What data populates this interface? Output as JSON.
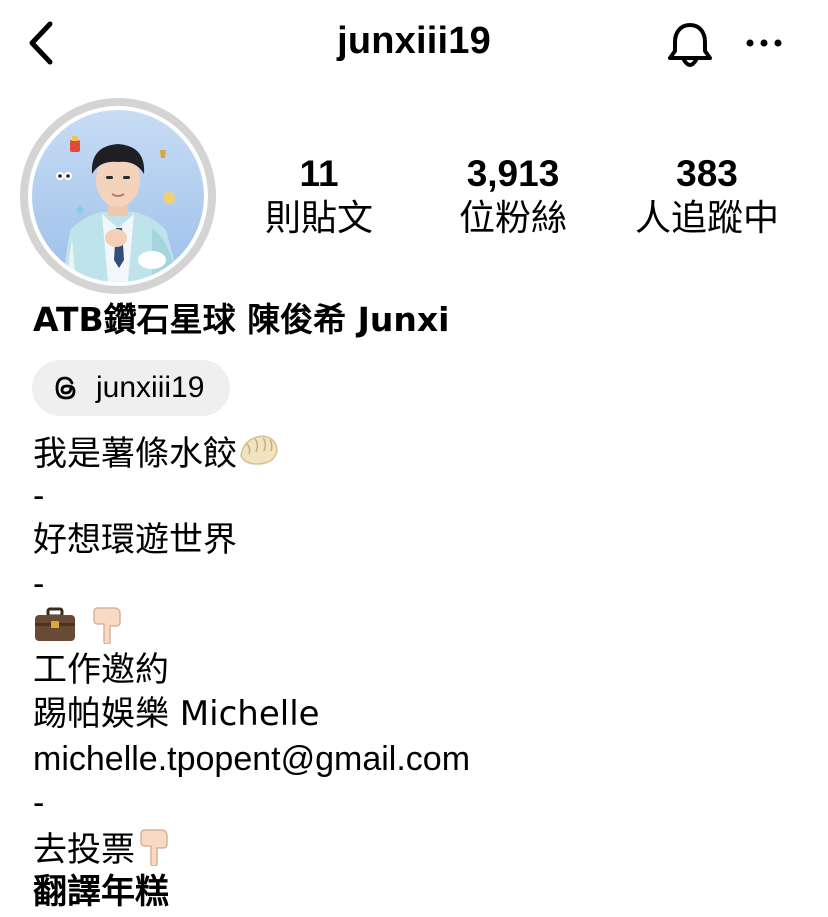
{
  "header": {
    "username": "junxiii19",
    "back_icon": "chevron-left-icon",
    "bell_icon": "bell-icon",
    "more_icon": "more-horizontal-icon"
  },
  "stats": [
    {
      "value": "11",
      "label": "則貼文"
    },
    {
      "value": "3,913",
      "label": "位粉絲"
    },
    {
      "value": "383",
      "label": "人追蹤中"
    }
  ],
  "profile": {
    "full_name": "ATB鑽石星球 陳俊希 Junxi",
    "threads_handle": "junxiii19",
    "threads_icon": "threads-icon"
  },
  "bio": {
    "line1": "我是薯條水餃",
    "line1_emoji": "dumpling-emoji",
    "dash1": "-",
    "line2": "好想環遊世界",
    "dash2": "-",
    "work_emojis": [
      "briefcase-emoji",
      "pointing-down-emoji"
    ],
    "line3": "工作邀約",
    "line4": "踢帕娛樂 Michelle",
    "line5": "michelle.tpopent@gmail.com",
    "dash3": "-",
    "line6": "去投票",
    "line6_emoji": "pointing-down-emoji",
    "line7": "翻譯年糕"
  },
  "colors": {
    "ring": "#d4d4d4",
    "pill_bg": "#efefef",
    "avatar_bg": "#a9c8ec",
    "text": "#000000"
  }
}
